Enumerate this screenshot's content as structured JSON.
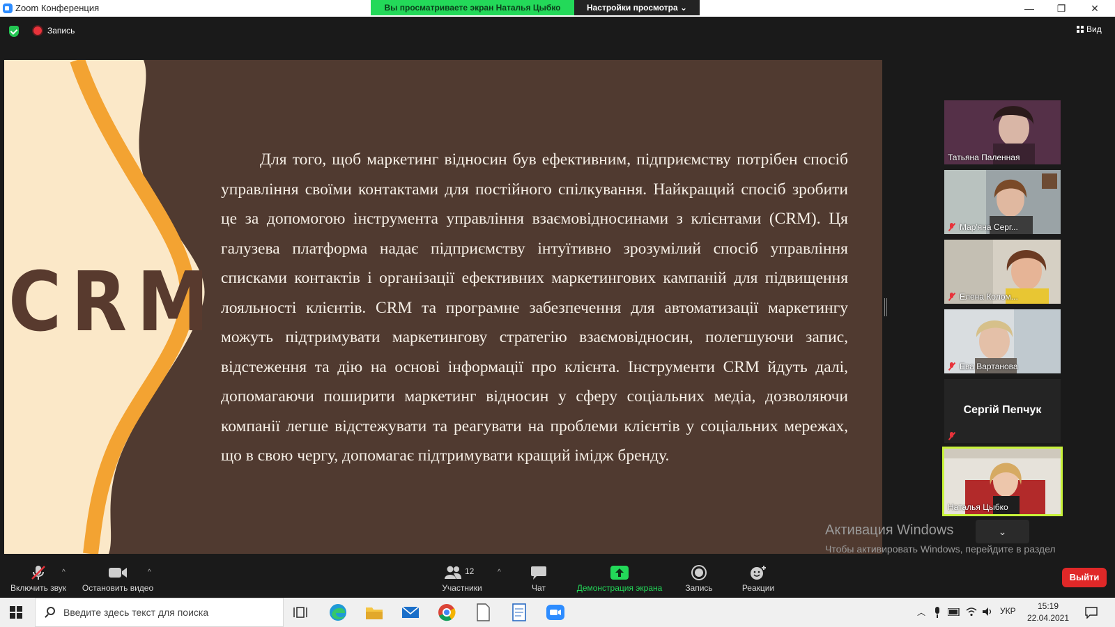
{
  "window": {
    "title": "Zoom Конференция",
    "share_banner": "Вы просматриваете экран Наталья Цыбко",
    "view_settings": "Настройки просмотра",
    "view_settings_caret": "⌄",
    "minimize": "—",
    "restore": "❐",
    "close": "✕"
  },
  "topbar": {
    "record_label": "Запись",
    "view_label": "Вид"
  },
  "slide": {
    "logo_text": "CRM",
    "body": "Для того, щоб маркетинг відносин був ефективним, підприємству потрібен спосіб управління своїми контактами для постійного спілкування. Найкращий спосіб зробити це за допомогою інструмента управління взаємовідносинами з клієнтами (CRM). Ця галузева платформа надає підприємству інтуїтивно зрозумілий спосіб управління списками контактів і організації ефективних маркетингових кампаній для підвищення лояльності клієнтів. CRM та програмне забезпечення для автоматизації маркетингу можуть підтримувати маркетингову стратегію взаємовідносин, полегшуючи запис, відстеження та дію на основі інформації про клієнта. Інструменти CRM йдуть далі, допомагаючи поширити маркетинг відносин у сферу соціальних медіа, дозволяючи компанії легше відстежувати та реагувати на проблеми клієнтів у соціальних мережах, що в свою чергу, допомагає підтримувати кращий імідж бренду.",
    "colors": {
      "background": "#503a30",
      "cream": "#fbe8c8",
      "orange": "#f3a332",
      "logo": "#583a2e"
    }
  },
  "participants": [
    {
      "name": "Татьяна Паленная",
      "muted": false
    },
    {
      "name": "Мар'яна Серг...",
      "muted": true
    },
    {
      "name": "Елена Колом...",
      "muted": true
    },
    {
      "name": "Ева Вартанова",
      "muted": true
    },
    {
      "name": "Сергій Пепчук",
      "muted": true,
      "video": false
    },
    {
      "name": "Наталья Цыбко",
      "muted": false,
      "active_speaker": true
    }
  ],
  "gallery": {
    "scroll_down_icon": "⌄"
  },
  "watermark": {
    "title": "Активация Windows",
    "text": "Чтобы активировать Windows, перейдите в раздел \"Параметры\"."
  },
  "toolbar": {
    "unmute_label": "Включить звук",
    "stop_video_label": "Остановить видео",
    "participants_label": "Участники",
    "participants_count": "12",
    "chat_label": "Чат",
    "share_label": "Демонстрация экрана",
    "record_label": "Запись",
    "reactions_label": "Реакции",
    "leave_label": "Выйти",
    "caret": "^",
    "share_color": "#23d959"
  },
  "taskbar": {
    "search_placeholder": "Введите здесь текст для поиска",
    "lang": "УКР",
    "time": "15:19",
    "date": "22.04.2021"
  }
}
